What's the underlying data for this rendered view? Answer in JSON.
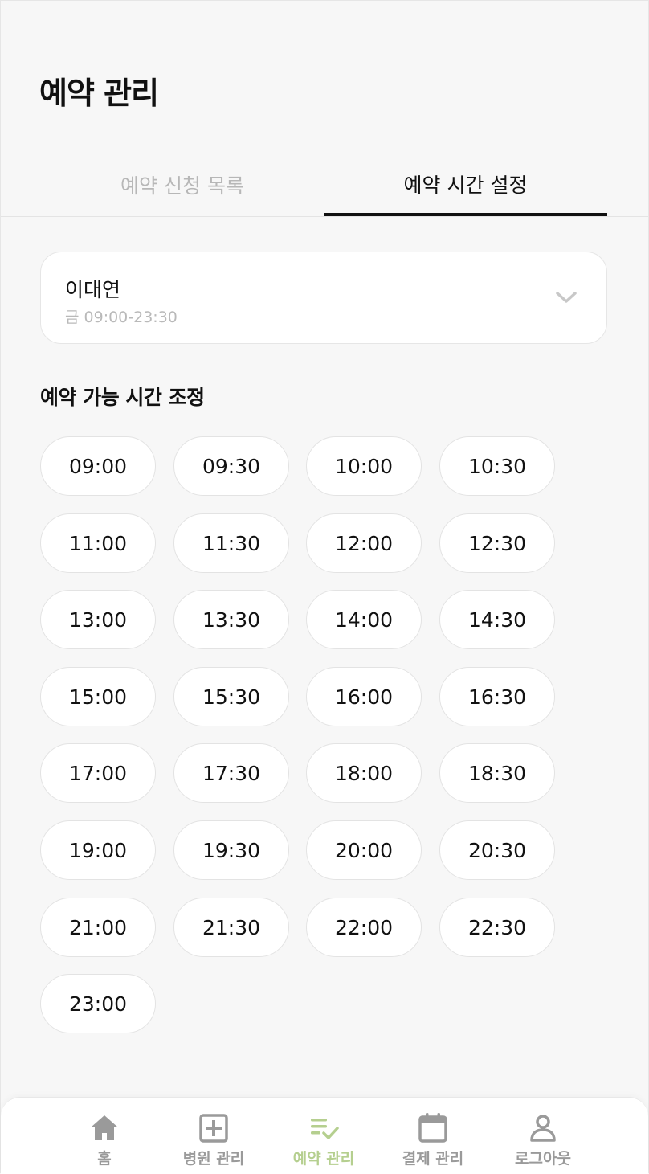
{
  "header": {
    "title": "예약 관리"
  },
  "tabs": [
    {
      "label": "예약 신청 목록",
      "active": false
    },
    {
      "label": "예약 시간 설정",
      "active": true
    }
  ],
  "doctor_select": {
    "name": "이대연",
    "hours": "금 09:00-23:30",
    "icon": "chevron-down-icon"
  },
  "availability": {
    "label": "예약 가능 시간 조정",
    "slots": [
      "09:00",
      "09:30",
      "10:00",
      "10:30",
      "11:00",
      "11:30",
      "12:00",
      "12:30",
      "13:00",
      "13:30",
      "14:00",
      "14:30",
      "15:00",
      "15:30",
      "16:00",
      "16:30",
      "17:00",
      "17:30",
      "18:00",
      "18:30",
      "19:00",
      "19:30",
      "20:00",
      "20:30",
      "21:00",
      "21:30",
      "22:00",
      "22:30",
      "23:00"
    ]
  },
  "bottom_nav": {
    "items": [
      {
        "label": "홈",
        "icon": "home-icon",
        "active": false
      },
      {
        "label": "병원 관리",
        "icon": "hospital-plus-icon",
        "active": false
      },
      {
        "label": "예약 관리",
        "icon": "list-check-icon",
        "active": true
      },
      {
        "label": "결제 관리",
        "icon": "calendar-icon",
        "active": false
      },
      {
        "label": "로그아웃",
        "icon": "user-icon",
        "active": false
      }
    ]
  },
  "colors": {
    "accent": "#b5cf8f",
    "inactive": "#9a9a9a",
    "background": "#f7f7f7",
    "text": "#111111",
    "muted": "#b7b7b7"
  }
}
